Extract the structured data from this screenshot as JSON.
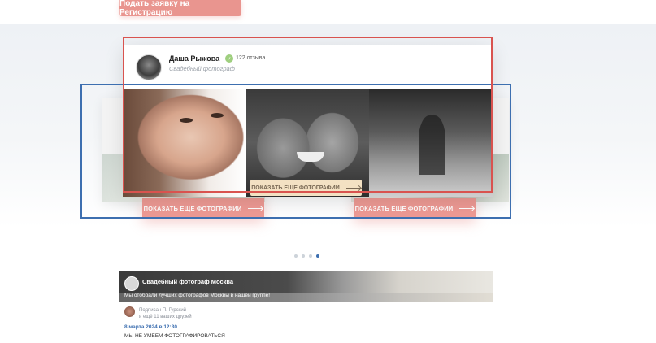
{
  "top_button": {
    "label": "Подать заявку на Регистрацию"
  },
  "profile": {
    "name": "Даша Рыжова",
    "reviews": "122 отзыва",
    "role": "Свадебный фотограф"
  },
  "carousel": {
    "show_more_label": "ПОКАЗАТЬ ЕЩЕ ФОТОГРАФИИ",
    "left_button_label": "ПОКАЗАТЬ ЕЩЕ ФОТОГРАФИИ",
    "right_button_label": "ПОКАЗАТЬ ЕЩЕ ФОТОГРАФИИ",
    "dots_count": 4,
    "active_dot": 4
  },
  "community": {
    "title": "Свадебный фотограф Москва",
    "description": "Мы отобрали лучших фотографов Москвы в нашей группе!",
    "subscriber_line1": "Подписан П. Гурский",
    "subscriber_line2": "и ещё 11 ваших друзей",
    "post_date": "8 марта 2024 в 12:30",
    "post_text": "МЫ НЕ УМЕЕМ ФОТОГРАФИРОВАТЬСЯ"
  },
  "colors": {
    "accent": "#ee9a94",
    "highlight_box": "#d9534f",
    "selection_box": "#3d6fb0"
  }
}
